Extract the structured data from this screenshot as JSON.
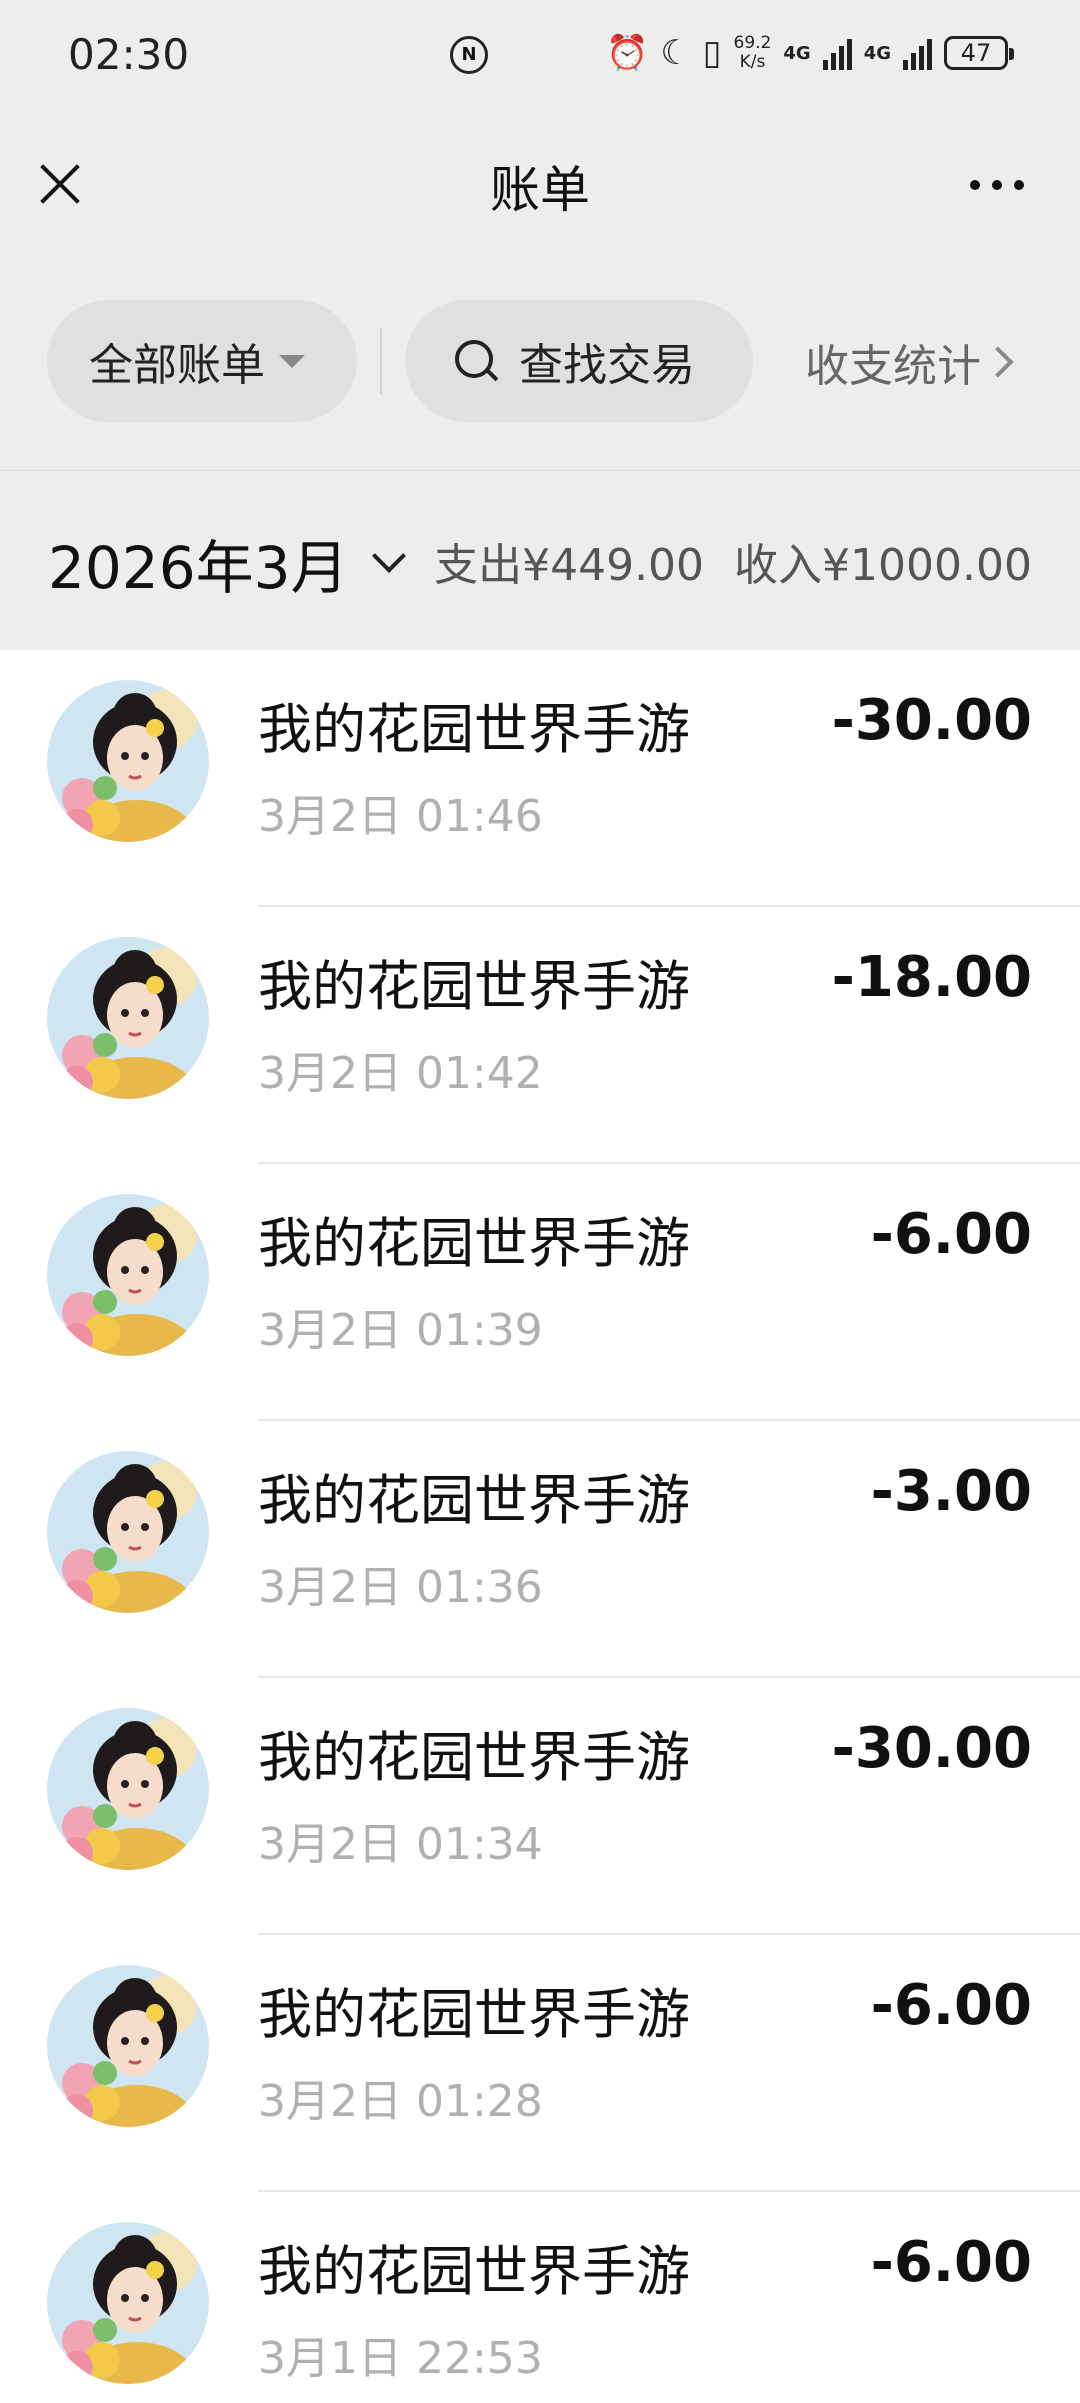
{
  "status": {
    "time": "02:30",
    "net_speed_top": "69.2",
    "net_speed_bottom": "K/s",
    "sim1": "4G",
    "sim2": "4G",
    "battery": "47"
  },
  "nav": {
    "title": "账单"
  },
  "filters": {
    "all_label": "全部账单",
    "search_label": "查找交易",
    "stats_label": "收支统计"
  },
  "summary": {
    "month": "2026年3月",
    "expense": "支出¥449.00",
    "income": "收入¥1000.00"
  },
  "transactions": [
    {
      "title": "我的花园世界手游",
      "time": "3月2日 01:46",
      "amount": "-30.00"
    },
    {
      "title": "我的花园世界手游",
      "time": "3月2日 01:42",
      "amount": "-18.00"
    },
    {
      "title": "我的花园世界手游",
      "time": "3月2日 01:39",
      "amount": "-6.00"
    },
    {
      "title": "我的花园世界手游",
      "time": "3月2日 01:36",
      "amount": "-3.00"
    },
    {
      "title": "我的花园世界手游",
      "time": "3月2日 01:34",
      "amount": "-30.00"
    },
    {
      "title": "我的花园世界手游",
      "time": "3月2日 01:28",
      "amount": "-6.00"
    },
    {
      "title": "我的花园世界手游",
      "time": "3月1日 22:53",
      "amount": "-6.00"
    }
  ]
}
